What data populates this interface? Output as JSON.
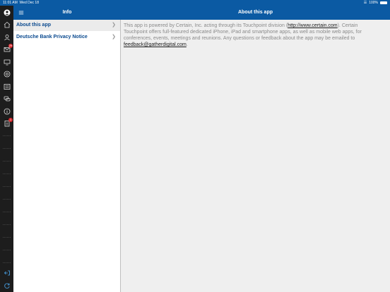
{
  "status_bar": {
    "time": "11:01 AM",
    "date": "Wed Dec 18",
    "battery": "100%"
  },
  "master_header": {
    "title": "Info"
  },
  "detail_header": {
    "title": "About this app"
  },
  "master_list": {
    "items": [
      {
        "label": "About this app",
        "selected": true
      },
      {
        "label": "Deutsche Bank Privacy Notice",
        "selected": false
      }
    ]
  },
  "detail": {
    "text_before_link": "This app is powered by Certain, Inc. acting through its Touchpoint division (",
    "link_url": "http://www.certain.com",
    "text_after_link": "). Certain Touchpoint offers full-featured dedicated iPhone, iPad and smartphone apps, as well as mobile web apps, for conferences, events, meetings and reunions. Any questions or feedback about the app may be emailed to ",
    "email": "feedback@gatherdigital.com",
    "text_end": "."
  },
  "rail": {
    "badges": {
      "messages": "29",
      "survey": "1"
    }
  },
  "colors": {
    "header_blue": "#0b5aa3",
    "rail_dark": "#1d1d1d",
    "badge_red": "#d9262b"
  }
}
